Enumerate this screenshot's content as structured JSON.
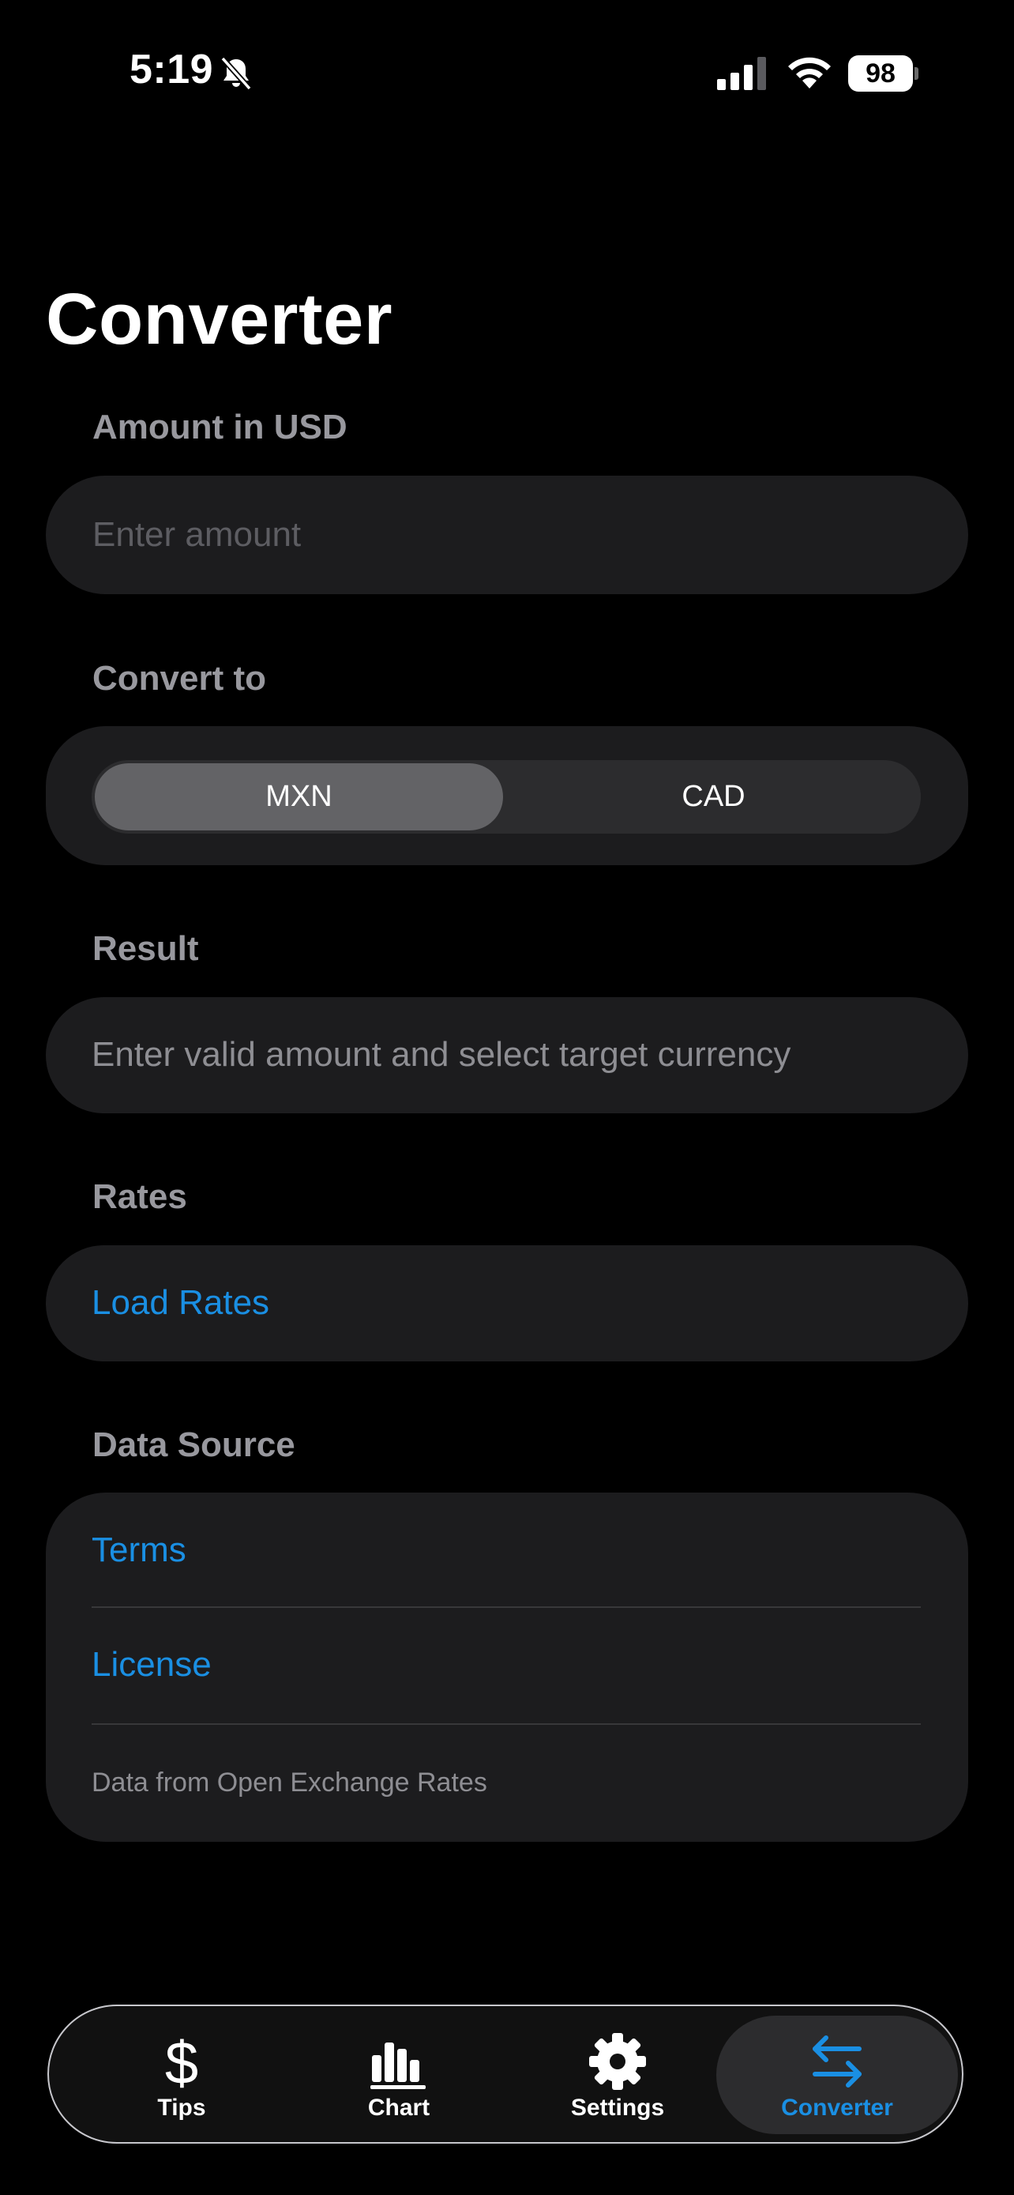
{
  "status_bar": {
    "time": "5:19",
    "battery": "98"
  },
  "page": {
    "title": "Converter"
  },
  "amount": {
    "label": "Amount in USD",
    "placeholder": "Enter amount",
    "value": ""
  },
  "convert_to": {
    "label": "Convert to",
    "options": [
      "MXN",
      "CAD"
    ],
    "selected": "MXN"
  },
  "result": {
    "label": "Result",
    "text": "Enter valid amount and select target currency"
  },
  "rates": {
    "label": "Rates",
    "load_button": "Load Rates"
  },
  "data_source": {
    "label": "Data Source",
    "terms": "Terms",
    "license": "License",
    "footnote": "Data from Open Exchange Rates"
  },
  "tab_bar": {
    "tabs": [
      {
        "label": "Tips",
        "icon": "dollar-icon"
      },
      {
        "label": "Chart",
        "icon": "bar-chart-icon"
      },
      {
        "label": "Settings",
        "icon": "gear-icon"
      },
      {
        "label": "Converter",
        "icon": "arrows-exchange-icon"
      }
    ],
    "active": "Converter"
  },
  "colors": {
    "accent": "#1a8fe3",
    "card": "#1c1c1e",
    "label": "#98989e",
    "background": "#000000"
  }
}
